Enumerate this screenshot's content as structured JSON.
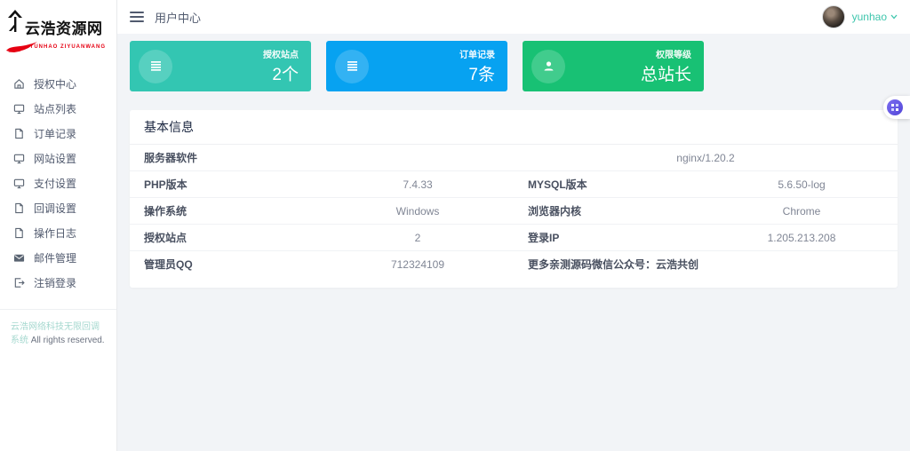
{
  "logo": {
    "title": "云浩资源网",
    "subtitle": "YUNHAO ZIYUANWANG",
    "mark_icon": "calligraphy-figure-icon",
    "accent_color": "#e60012"
  },
  "topbar": {
    "title": "用户中心",
    "menu_icon": "hamburger-icon",
    "username": "yunhao",
    "username_color": "#3fc6ad",
    "caret_icon": "chevron-down-icon"
  },
  "sidebar": {
    "items": [
      {
        "label": "授权中心",
        "icon": "home-icon"
      },
      {
        "label": "站点列表",
        "icon": "monitor-icon"
      },
      {
        "label": "订单记录",
        "icon": "file-icon"
      },
      {
        "label": "网站设置",
        "icon": "monitor-icon"
      },
      {
        "label": "支付设置",
        "icon": "monitor-icon"
      },
      {
        "label": "回调设置",
        "icon": "file-icon"
      },
      {
        "label": "操作日志",
        "icon": "file-icon"
      },
      {
        "label": "邮件管理",
        "icon": "mail-icon"
      },
      {
        "label": "注销登录",
        "icon": "logout-icon"
      }
    ],
    "footer_brand": "云浩网络科技无限回调系统",
    "footer_rights": "All rights reserved."
  },
  "stats": {
    "cards": [
      {
        "label": "授权站点",
        "value": "2个",
        "color": "#33c6b2",
        "icon": "list-icon"
      },
      {
        "label": "订单记录",
        "value": "7条",
        "color": "#07a2f1",
        "icon": "list-icon"
      },
      {
        "label": "权限等级",
        "value": "总站长",
        "color": "#18c174",
        "icon": "user-icon"
      }
    ]
  },
  "panel": {
    "title": "基本信息",
    "server_software": {
      "label": "服务器软件",
      "value": "nginx/1.20.2"
    },
    "php_version": {
      "label": "PHP版本",
      "value": "7.4.33"
    },
    "mysql_version": {
      "label": "MYSQL版本",
      "value": "5.6.50-log"
    },
    "os": {
      "label": "操作系统",
      "value": "Windows"
    },
    "browser_kernel": {
      "label": "浏览器内核",
      "value": "Chrome"
    },
    "auth_sites": {
      "label": "授权站点",
      "value": "2"
    },
    "login_ip": {
      "label": "登录IP",
      "value": "1.205.213.208"
    },
    "admin_qq": {
      "label": "管理员QQ",
      "value": "712324109"
    },
    "promo_text": "更多亲测源码微信公众号：云浩共创"
  },
  "float_widget": {
    "icon": "assistant-plugin-icon"
  }
}
